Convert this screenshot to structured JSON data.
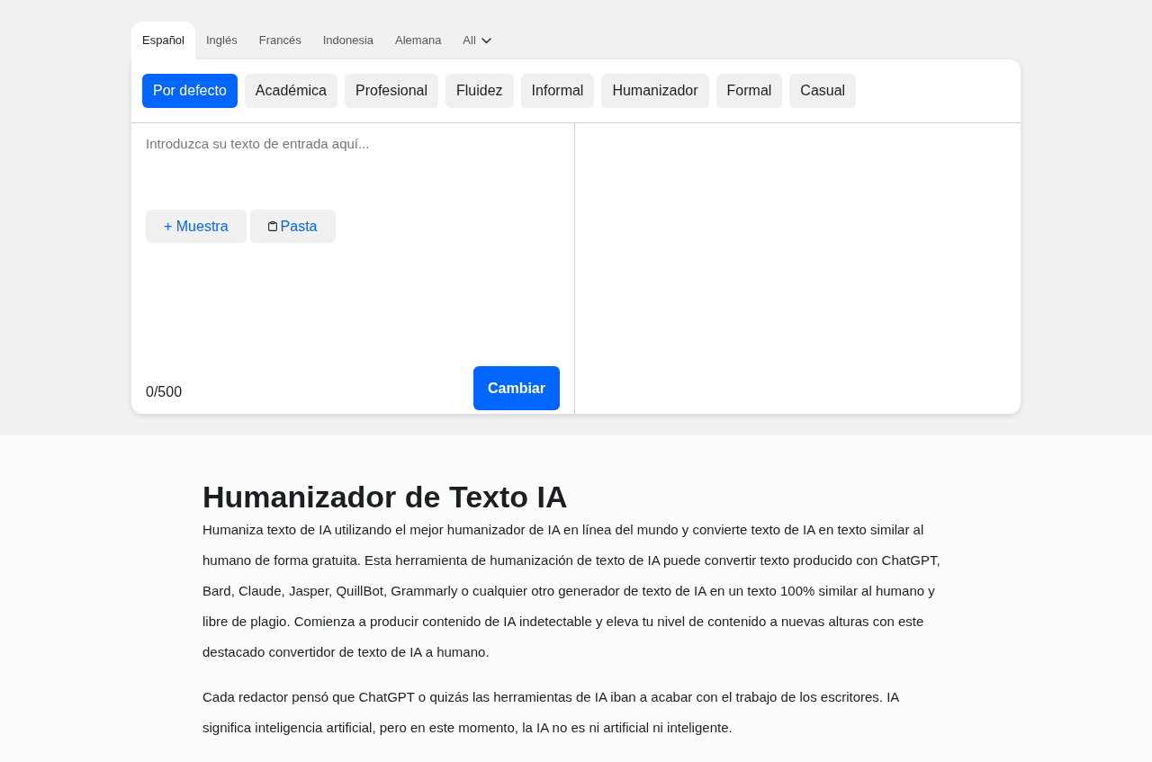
{
  "language_tabs": [
    {
      "label": "Español",
      "selected": true
    },
    {
      "label": "Inglés",
      "selected": false
    },
    {
      "label": "Francés",
      "selected": false
    },
    {
      "label": "Indonesia",
      "selected": false
    },
    {
      "label": "Alemana",
      "selected": false
    }
  ],
  "language_dropdown": {
    "label": "All"
  },
  "modes": [
    {
      "label": "Por defecto",
      "selected": true
    },
    {
      "label": "Académica",
      "selected": false
    },
    {
      "label": "Profesional",
      "selected": false
    },
    {
      "label": "Fluidez",
      "selected": false
    },
    {
      "label": "Informal",
      "selected": false
    },
    {
      "label": "Humanizador",
      "selected": false
    },
    {
      "label": "Formal",
      "selected": false
    },
    {
      "label": "Casual",
      "selected": false
    }
  ],
  "input": {
    "placeholder": "Introduzca su texto de entrada aquí..."
  },
  "input_buttons": [
    {
      "kind": "sample",
      "label": "+ Muestra"
    },
    {
      "kind": "paste",
      "label": "Pasta"
    }
  ],
  "counter": "0/500",
  "submit": {
    "label": "Cambiar"
  },
  "article": {
    "title": "Humanizador de Texto IA",
    "paragraphs": [
      "Humaniza texto de IA utilizando el mejor humanizador de IA en línea del mundo y convierte texto de IA en texto similar al humano de forma gratuita. Esta herramienta de humanización de texto de IA puede convertir texto producido con ChatGPT, Bard, Claude, Jasper, QuillBot, Grammarly o cualquier otro generador de texto de IA en un texto 100% similar al humano y libre de plagio. Comienza a producir contenido de IA indetectable y eleva tu nivel de contenido a nuevas alturas con este destacado convertidor de texto de IA a humano.",
      "Cada redactor pensó que ChatGPT o quizás las herramientas de IA iban a acabar con el trabajo de los escritores. IA significa inteligencia artificial, pero en este momento, la IA no es ni artificial ni inteligente."
    ]
  }
}
